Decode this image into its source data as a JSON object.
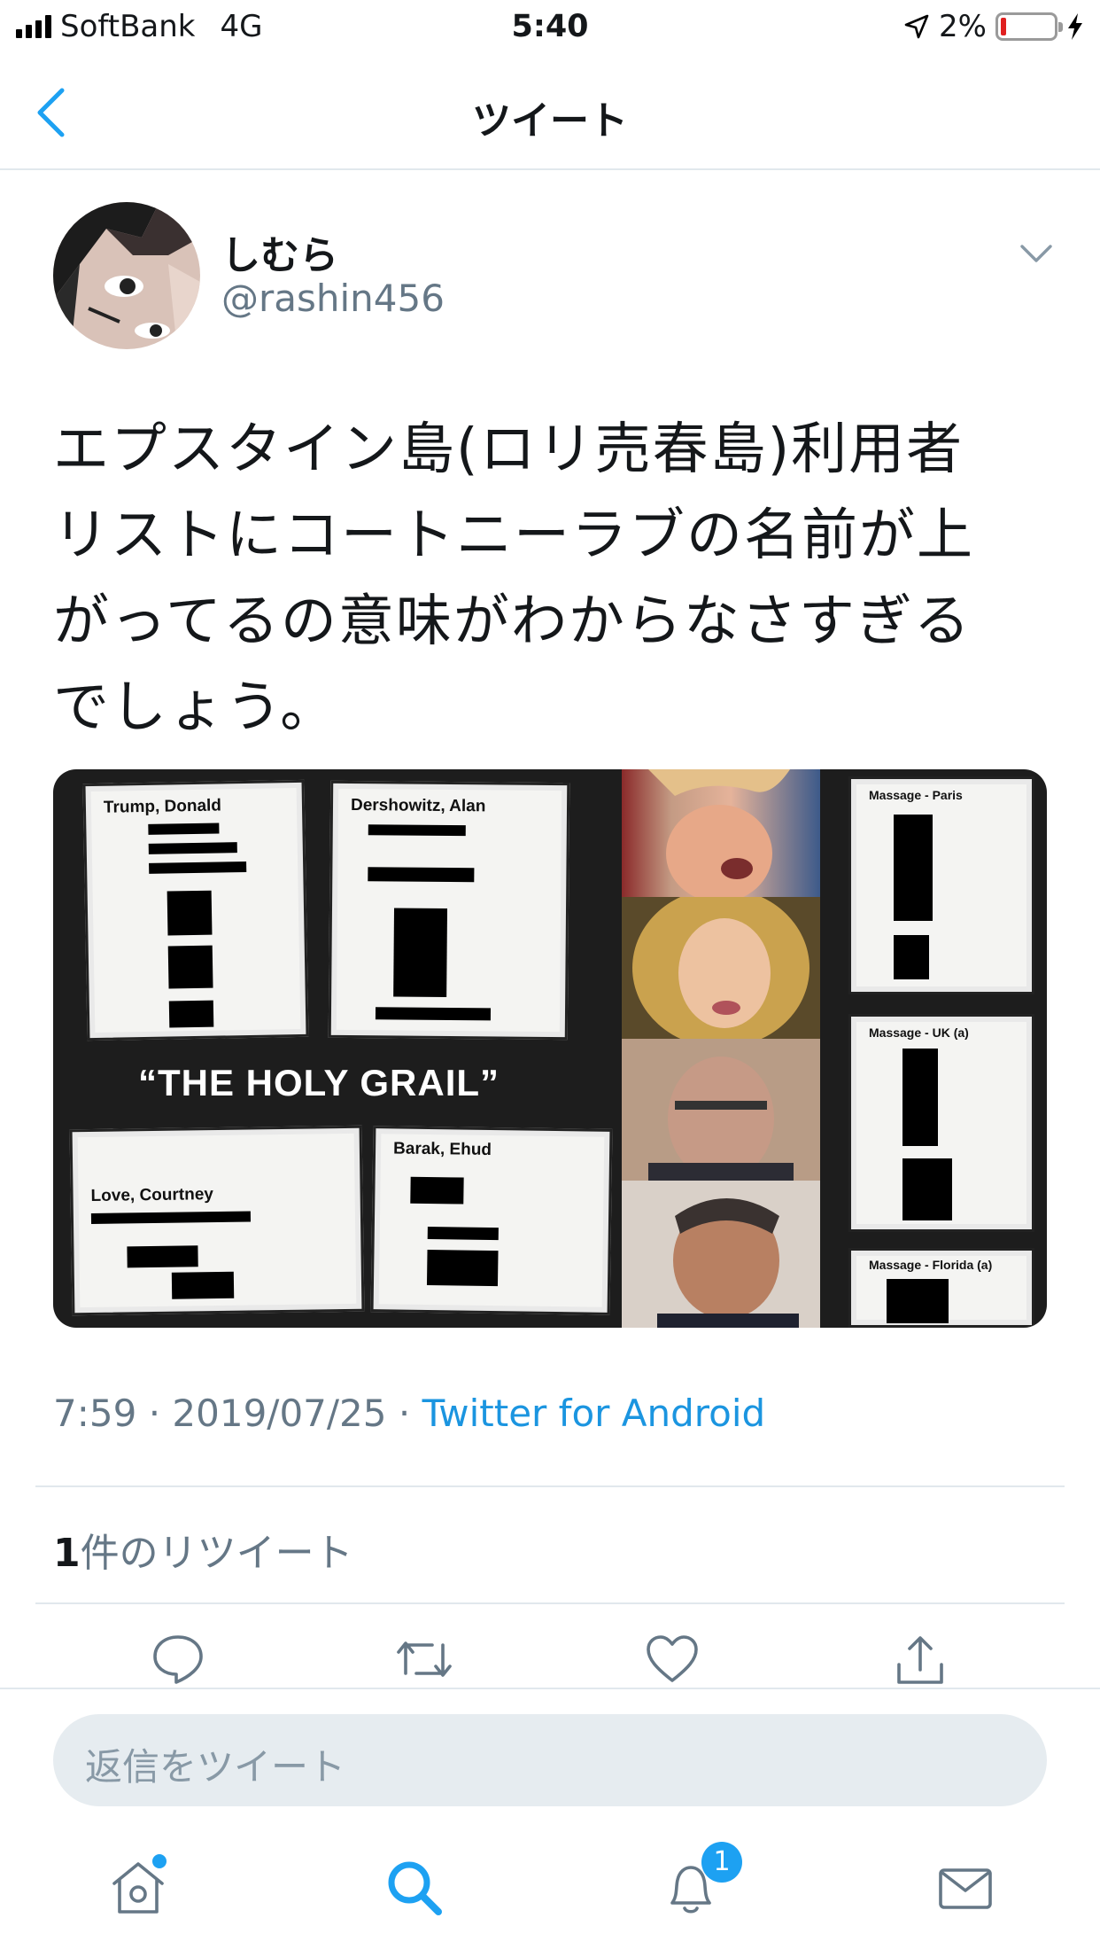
{
  "status_bar": {
    "carrier": "SoftBank",
    "network": "4G",
    "time": "5:40",
    "battery": "2%"
  },
  "nav": {
    "title": "ツイート"
  },
  "tweet": {
    "display_name": "しむら",
    "handle": "@rashin456",
    "text_lines": [
      "エプスタイン島(ロリ売春島)利用者",
      "リストにコートニーラブの名前が上",
      "がってるの意味がわからなさすぎる",
      "でしょう。"
    ],
    "media": {
      "caption": "“THE HOLY GRAIL”",
      "docs": [
        {
          "title": "Trump, Donald"
        },
        {
          "title": "Dershowitz, Alan"
        },
        {
          "title": "Massage - Paris"
        },
        {
          "title": "Massage - UK (a)"
        },
        {
          "title": "Love, Courtney"
        },
        {
          "title": "Barak, Ehud"
        },
        {
          "title": "Massage - Florida (a)"
        }
      ]
    },
    "time": "7:59",
    "date": "2019/07/25",
    "separator": "·",
    "source": "Twitter for Android",
    "retweet_count": "1",
    "retweet_label": "件のリツイート"
  },
  "reply": {
    "placeholder": "返信をツイート"
  },
  "tab_bar": {
    "notification_badge": "1"
  },
  "colors": {
    "accent": "#1da1f2",
    "link": "#1b95e0",
    "secondary_text": "#657786",
    "battery_low": "#e02020"
  }
}
